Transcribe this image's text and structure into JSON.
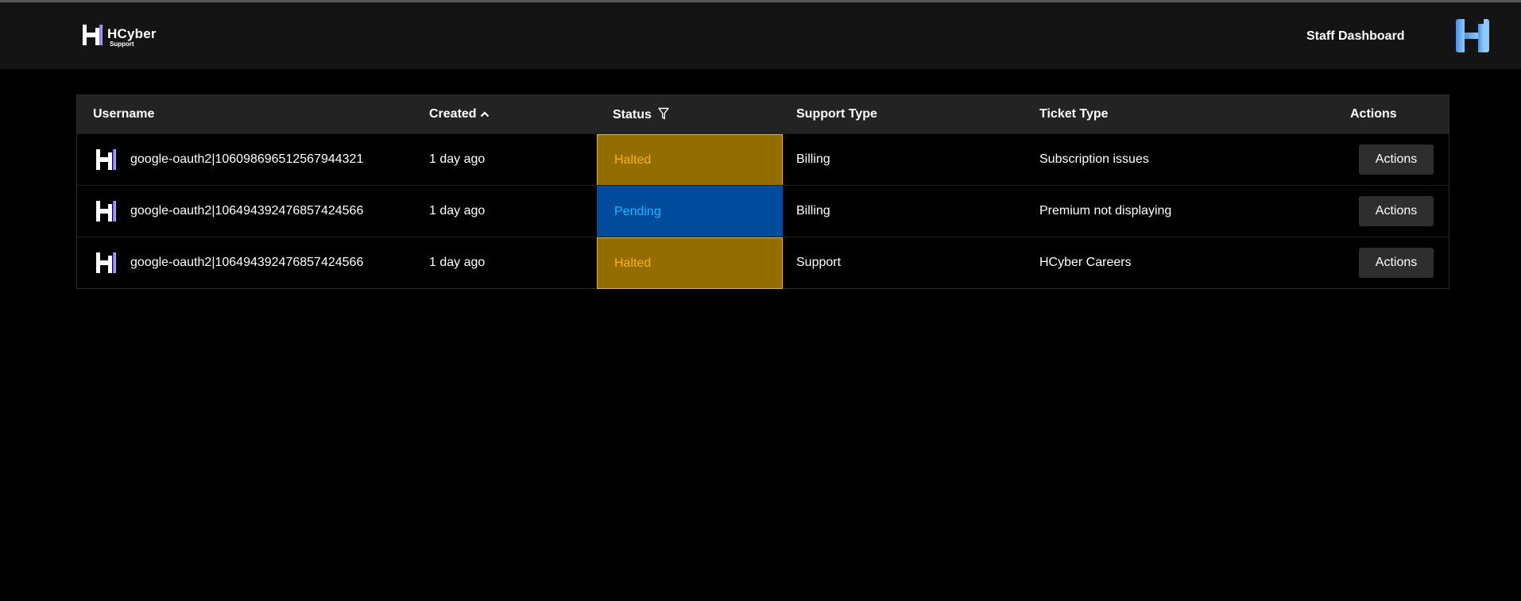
{
  "brand": {
    "name": "HCyber",
    "sub": "Support"
  },
  "nav": {
    "staff_dashboard": "Staff Dashboard"
  },
  "colors": {
    "background": "#000000",
    "navbar": "#141414",
    "header_row": "#232323",
    "halted_bg": "#946d00",
    "halted_text": "#ffb300",
    "pending_bg": "#004b9c",
    "pending_text": "#1ab6ff",
    "accent_logo": "#5aa9f0"
  },
  "table": {
    "headers": {
      "username": "Username",
      "created": "Created",
      "status": "Status",
      "support_type": "Support Type",
      "ticket_type": "Ticket Type",
      "actions": "Actions"
    },
    "sort": {
      "column": "Created",
      "icon": "chevron-up-icon"
    },
    "filter_icon": "filter-icon",
    "rows": [
      {
        "username": "google-oauth2|106098696512567944321",
        "created": "1 day ago",
        "status": "Halted",
        "support_type": "Billing",
        "ticket_type": "Subscription issues",
        "action_label": "Actions"
      },
      {
        "username": "google-oauth2|106494392476857424566",
        "created": "1 day ago",
        "status": "Pending",
        "support_type": "Billing",
        "ticket_type": "Premium not displaying",
        "action_label": "Actions"
      },
      {
        "username": "google-oauth2|106494392476857424566",
        "created": "1 day ago",
        "status": "Halted",
        "support_type": "Support",
        "ticket_type": "HCyber Careers",
        "action_label": "Actions"
      }
    ]
  }
}
